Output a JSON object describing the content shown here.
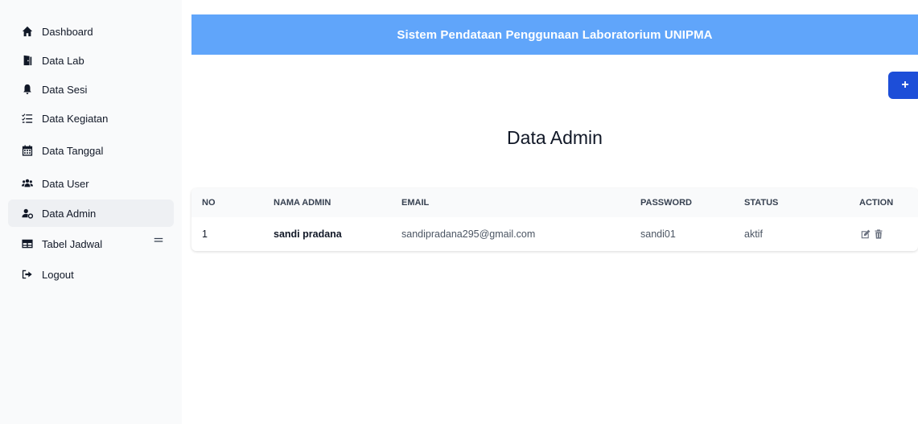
{
  "sidebar": {
    "items": [
      {
        "label": "Dashboard",
        "icon": "home-icon"
      },
      {
        "label": "Data Lab",
        "icon": "door-icon"
      },
      {
        "label": "Data Sesi",
        "icon": "bell-icon"
      },
      {
        "label": "Data Kegiatan",
        "icon": "list-check-icon"
      },
      {
        "label": "Data Tanggal",
        "icon": "calendar-icon"
      },
      {
        "label": "Data User",
        "icon": "users-icon"
      },
      {
        "label": "Data Admin",
        "icon": "user-gear-icon",
        "active": true
      },
      {
        "label": "Tabel Jadwal",
        "icon": "table-icon"
      },
      {
        "label": "Logout",
        "icon": "logout-icon"
      }
    ]
  },
  "header": {
    "title": "Sistem Pendataan Penggunaan Laboratorium UNIPMA"
  },
  "add_button": {
    "label": "+"
  },
  "main": {
    "title": "Data Admin"
  },
  "table": {
    "columns": [
      "NO",
      "NAMA ADMIN",
      "EMAIL",
      "PASSWORD",
      "STATUS",
      "ACTION"
    ],
    "rows": [
      {
        "no": "1",
        "name": "sandi pradana",
        "email": "sandipradana295@gmail.com",
        "password": "sandi01",
        "status": "aktif"
      }
    ]
  },
  "colors": {
    "banner": "#60a5fa",
    "primary_button": "#1d4ed8",
    "sidebar_bg": "#f9fafb"
  }
}
